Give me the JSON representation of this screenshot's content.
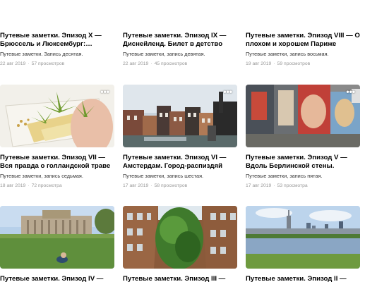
{
  "cards": [
    {
      "title": "Путевые заметки. Эпизод X — Брюссель и Люксембург:…",
      "desc": "Путевые заметки. Запись десятая.",
      "date": "22 авг 2019",
      "views": "57 просмотров",
      "image": "brussels-park-photo"
    },
    {
      "title": "Путевые заметки. Эпизод IX — Диснейленд. Билет в детство",
      "desc": "Путевые заметки, запись девятая.",
      "date": "22 авг 2019",
      "views": "45 просмотров",
      "image": "disneyland-photo"
    },
    {
      "title": "Путевые заметки. Эпизод VIII — О плохом и хорошем Париже",
      "desc": "Путевые заметки, запись восьмая.",
      "date": "19 авг 2019",
      "views": "59 просмотров",
      "image": "paris-photo"
    },
    {
      "title": "Путевые заметки. Эпизод VII — Вся правда о голландской траве",
      "desc": "Путевые заметки, запись седьмая.",
      "date": "18 авг 2019",
      "views": "72 просмотра",
      "image": "cannabis-leaf-card-photo"
    },
    {
      "title": "Путевые заметки. Эпизод VI — Амстердам. Город-распиздяй",
      "desc": "Путевые заметки, запись шестая.",
      "date": "17 авг 2019",
      "views": "58 просмотров",
      "image": "amsterdam-canal-photo"
    },
    {
      "title": "Путевые заметки. Эпизод V — Вдоль Берлинской стены.",
      "desc": "Путевые заметки, запись пятая.",
      "date": "17 авг 2019",
      "views": "53 просмотра",
      "image": "berlin-wall-mural-photo"
    },
    {
      "title": "Путевые заметки. Эпизод IV —",
      "desc": "",
      "date": "",
      "views": "",
      "image": "reichstag-photo"
    },
    {
      "title": "Путевые заметки. Эпизод III —",
      "desc": "",
      "date": "",
      "views": "",
      "image": "green-courtyard-photo"
    },
    {
      "title": "Путевые заметки. Эпизод II —",
      "desc": "",
      "date": "",
      "views": "",
      "image": "warsaw-skyline-photo"
    }
  ],
  "more_label": "•••",
  "meta_separator": "·"
}
